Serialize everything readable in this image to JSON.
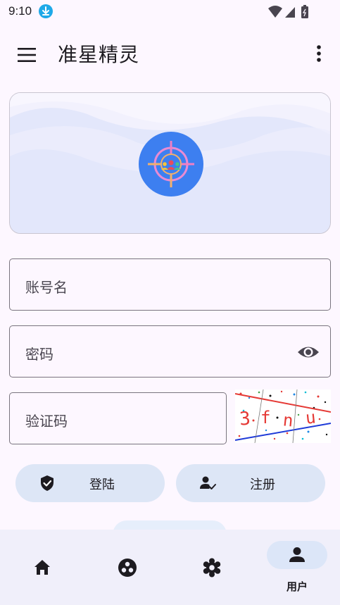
{
  "status_bar": {
    "time": "9:10"
  },
  "app_bar": {
    "title": "准星精灵"
  },
  "form": {
    "account_placeholder": "账号名",
    "password_placeholder": "密码",
    "captcha_placeholder": "验证码",
    "captcha_text": "3fnu"
  },
  "actions": {
    "login_label": "登陆",
    "register_label": "注册"
  },
  "bottom_nav": {
    "items": [
      {
        "name": "home",
        "icon": "home-icon",
        "label": ""
      },
      {
        "name": "game",
        "icon": "game-icon",
        "label": ""
      },
      {
        "name": "settings",
        "icon": "settings-icon",
        "label": ""
      },
      {
        "name": "user",
        "icon": "person-icon",
        "label": "用户"
      }
    ],
    "selected": "user"
  },
  "colors": {
    "background": "#fdf7ff",
    "accent_pill": "#dde6f6",
    "logo_blue": "#3d7ff0"
  }
}
